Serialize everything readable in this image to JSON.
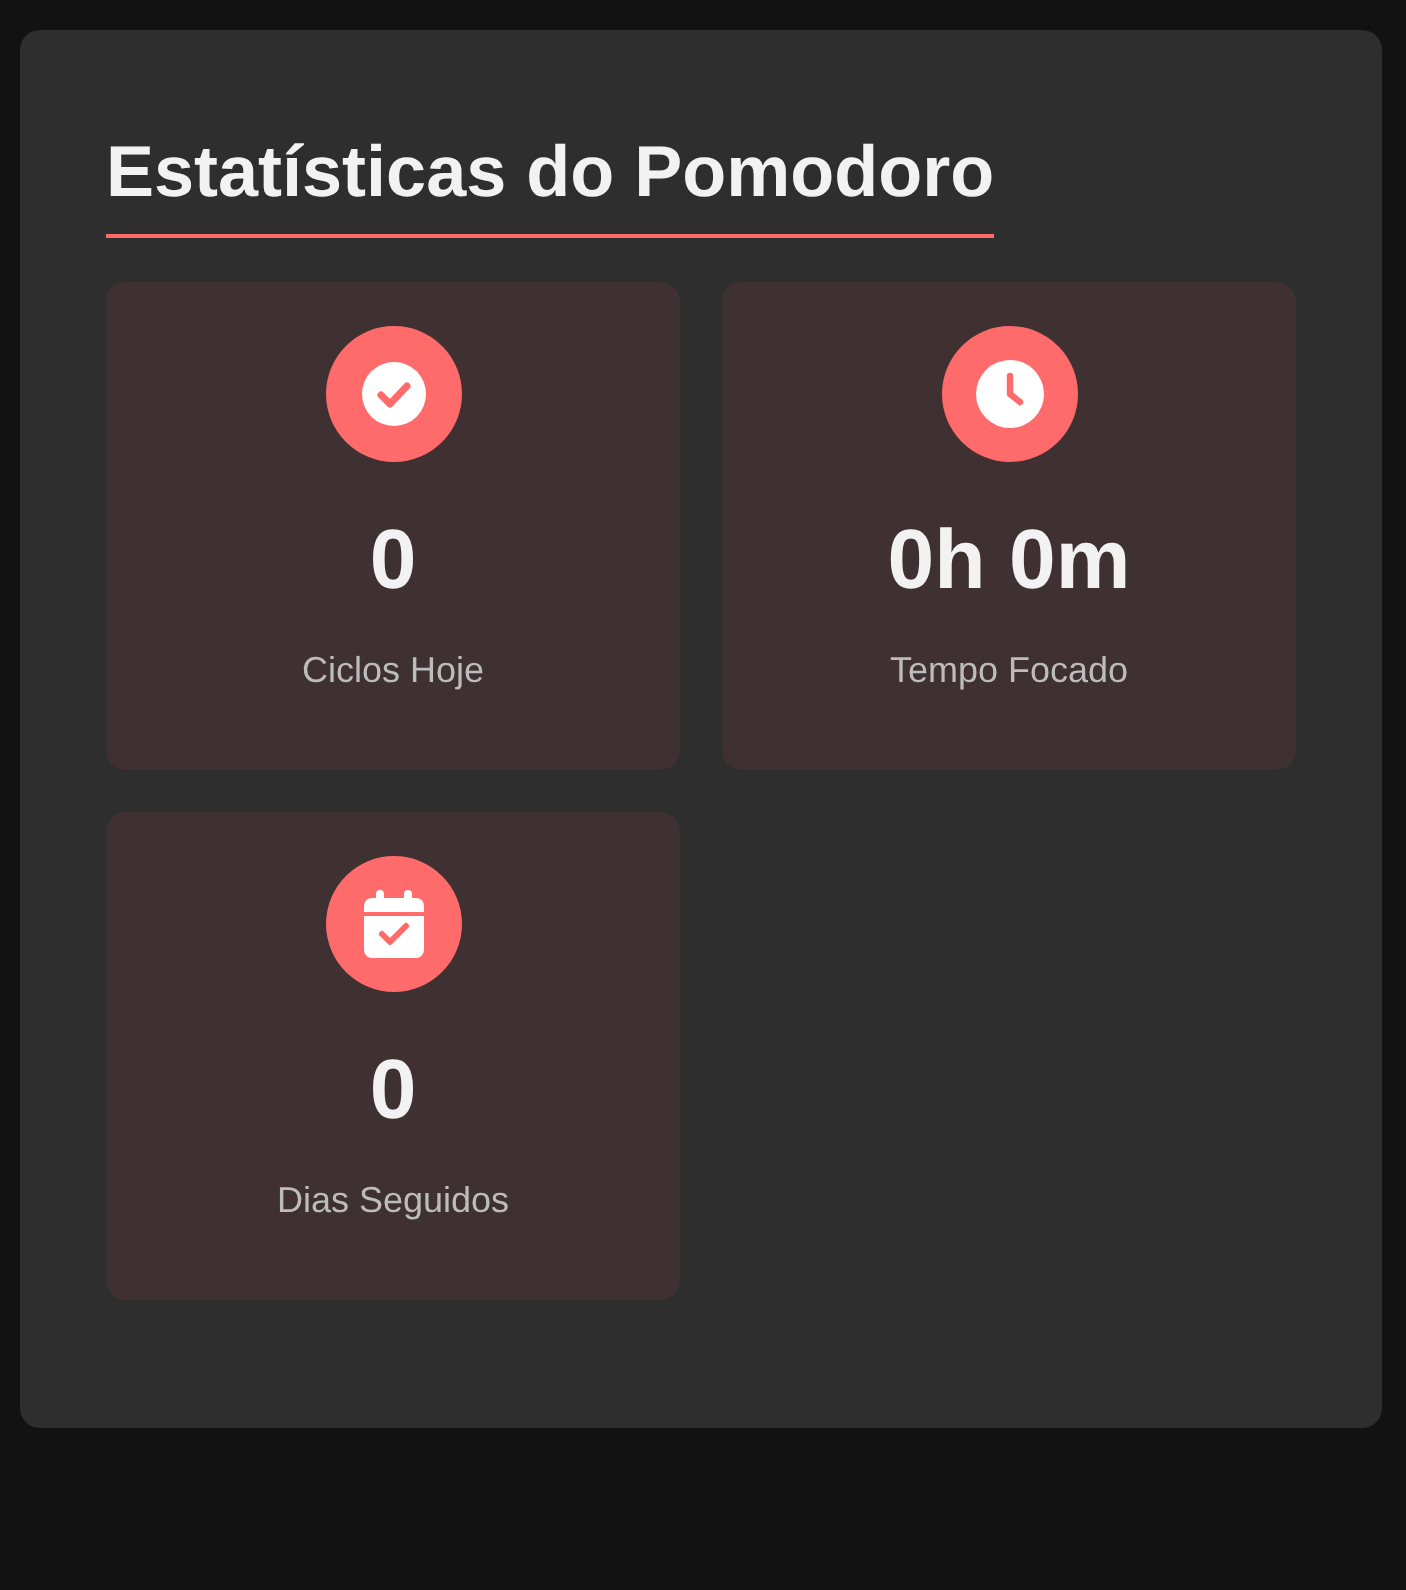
{
  "title": "Estatísticas do Pomodoro",
  "stats": [
    {
      "kind": "check",
      "value": "0",
      "label": "Ciclos Hoje"
    },
    {
      "kind": "clock",
      "value": "0h 0m",
      "label": "Tempo Focado"
    },
    {
      "kind": "calendar",
      "value": "0",
      "label": "Dias Seguidos"
    }
  ]
}
